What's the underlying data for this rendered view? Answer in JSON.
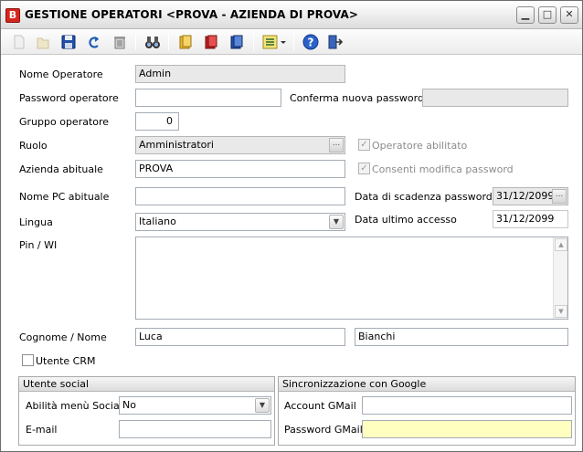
{
  "window": {
    "app_icon_letter": "B",
    "title": "GESTIONE OPERATORI <PROVA - AZIENDA DI PROVA>",
    "controls": {
      "minimize": "▁",
      "maximize": "□",
      "close": "✕"
    }
  },
  "toolbar": {
    "buttons": [
      {
        "name": "new-icon",
        "enabled": false
      },
      {
        "name": "open-icon",
        "enabled": false
      },
      {
        "name": "save-icon",
        "enabled": true
      },
      {
        "name": "undo-icon",
        "enabled": true
      },
      {
        "name": "delete-icon",
        "enabled": true
      },
      {
        "name": "search-binoculars-icon",
        "enabled": true
      },
      {
        "name": "book-yellow-icon",
        "enabled": true
      },
      {
        "name": "book-red-icon",
        "enabled": true
      },
      {
        "name": "book-blue-icon",
        "enabled": true
      },
      {
        "name": "list-dropdown-icon",
        "enabled": true
      },
      {
        "name": "help-icon",
        "enabled": true
      },
      {
        "name": "exit-icon",
        "enabled": true
      }
    ]
  },
  "form": {
    "nome_operatore": {
      "label": "Nome Operatore",
      "value": "Admin"
    },
    "password": {
      "label": "Password operatore",
      "value": ""
    },
    "conferma_password": {
      "label": "Conferma nuova password",
      "value": ""
    },
    "gruppo": {
      "label": "Gruppo operatore",
      "value": "0"
    },
    "ruolo": {
      "label": "Ruolo",
      "value": "Amministratori"
    },
    "operatore_abilitato": {
      "label": "Operatore abilitato",
      "checked": true
    },
    "azienda_abituale": {
      "label": "Azienda abituale",
      "value": "PROVA"
    },
    "consenti_modifica": {
      "label": "Consenti modifica password",
      "checked": true
    },
    "nome_pc": {
      "label": "Nome PC abituale",
      "value": ""
    },
    "data_scadenza": {
      "label": "Data di scadenza password",
      "value": "31/12/2099"
    },
    "lingua": {
      "label": "Lingua",
      "value": "Italiano"
    },
    "data_ultimo_accesso": {
      "label": "Data ultimo accesso",
      "value": "31/12/2099"
    },
    "pin_wi": {
      "label": "Pin / WI",
      "value": ""
    },
    "cognome_nome": {
      "label": "Cognome /  Nome",
      "cognome": "Luca",
      "nome": "Bianchi"
    },
    "utente_crm": {
      "label": "Utente CRM",
      "checked": false
    }
  },
  "social": {
    "header": "Utente social",
    "abilita_menu": {
      "label": "Abilità menù Social",
      "value": "No"
    },
    "email": {
      "label": "E-mail",
      "value": ""
    }
  },
  "google": {
    "header": "Sincronizzazione con Google",
    "account": {
      "label": "Account GMail",
      "value": ""
    },
    "password": {
      "label": "Password GMail",
      "value": ""
    }
  },
  "colors": {
    "highlight_field": "#ffffc0",
    "readonly_field": "#e9e9e9",
    "app_icon": "#d6261e"
  }
}
